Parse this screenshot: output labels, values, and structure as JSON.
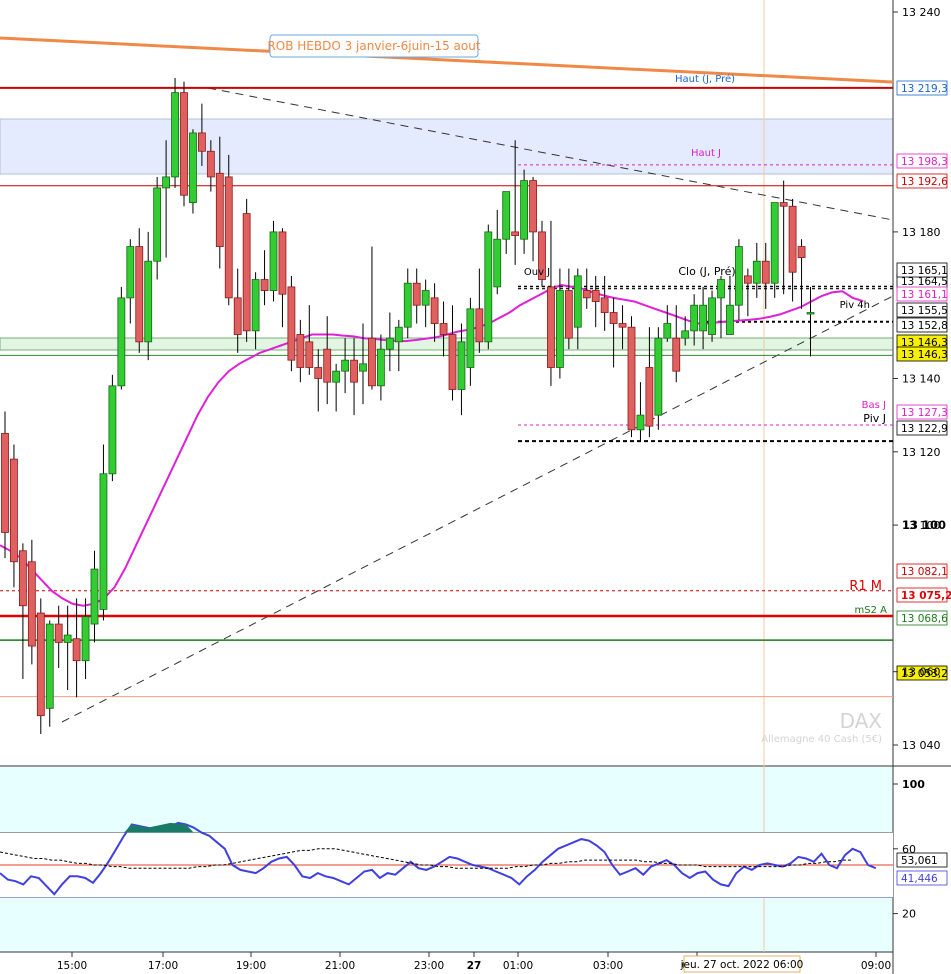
{
  "chart_data": {
    "type": "candlestick",
    "instrument": "DAX",
    "instrument_sub": "Allemagne 40 Cash (5€)",
    "annotation_box": "ROB HEBDO 3 janvier-6juin-15 aout",
    "time_labels": [
      "15:00",
      "17:00",
      "19:00",
      "21:00",
      "23:00",
      "27",
      "01:00",
      "03:00",
      "05:00",
      "09:00"
    ],
    "crosshair_time_label": "jeu. 27 oct. 2022 06:00",
    "price_ticks": [
      "13 240",
      "13 180",
      "13 140",
      "13 120",
      "13 100",
      "13 060",
      "13 040"
    ],
    "y_range": [
      13030,
      13244
    ],
    "price_levels": [
      {
        "label": "Haut (J, Pré)",
        "price": 13219.3,
        "tag": "13 219,3",
        "color": "#cc0000",
        "tag_color": "#1a66cc"
      },
      {
        "label": "Haut J",
        "price": 13198.3,
        "tag": "13 198,3",
        "color": "#e020c8",
        "tag_color": "#e020c8"
      },
      {
        "label": "",
        "price": 13192.6,
        "tag": "13 192,6",
        "color": "#cc0000",
        "tag_color": "#cc0000"
      },
      {
        "label": "Ouv J",
        "price": 13164.5,
        "tag": "13 164,5",
        "color": "#000000",
        "tag_color": "#000000"
      },
      {
        "label": "Clo (J, Pré)",
        "price": 13165.1,
        "tag": "13 165,1",
        "color": "#000000",
        "tag_color": "#000000"
      },
      {
        "label": "",
        "price": 13161.1,
        "tag": "13 161,1",
        "color": "#e020c8",
        "tag_color": "#e020c8"
      },
      {
        "label": "Piv 4h",
        "price": 13155.5,
        "tag": "13 155,5",
        "color": "#000000",
        "tag_color": "#000000"
      },
      {
        "label": "",
        "price": 13152.8,
        "tag": "13 152,8",
        "color": "#000000",
        "tag_color": "#000000"
      },
      {
        "label": "",
        "price": 13146.3,
        "tag": "13 146,3",
        "color": "#2e8b2e",
        "tag_color": "#000000"
      },
      {
        "label": "Bas J",
        "price": 13127.3,
        "tag": "13 127,3",
        "color": "#e020c8",
        "tag_color": "#e020c8"
      },
      {
        "label": "Piv J",
        "price": 13122.9,
        "tag": "13 122,9",
        "color": "#000000",
        "tag_color": "#000000"
      },
      {
        "label": "",
        "price": 13082.1,
        "tag": "13 082,1",
        "color": "#cc0000",
        "tag_color": "#cc0000"
      },
      {
        "label": "R1 M",
        "price": 13075.2,
        "tag": "13 075,2",
        "color": "#e00000",
        "tag_color": "#e00000"
      },
      {
        "label": "mS2 A",
        "price": 13068.6,
        "tag": "13 068,6",
        "color": "#1a7a1a",
        "tag_color": "#1a7a1a"
      },
      {
        "label": "",
        "price": 13053.2,
        "tag": "13 053,2",
        "color": "#f0a080",
        "tag_color": "#000000"
      }
    ],
    "candles": [
      [
        13125,
        13131,
        13091,
        13098
      ],
      [
        13118,
        13122,
        13083,
        13090
      ],
      [
        13093,
        13095,
        13058,
        13078
      ],
      [
        13090,
        13096,
        13062,
        13067
      ],
      [
        13076,
        13080,
        13043,
        13048
      ],
      [
        13050,
        13074,
        13045,
        13073
      ],
      [
        13073,
        13078,
        13061,
        13068
      ],
      [
        13068,
        13078,
        13055,
        13070
      ],
      [
        13069,
        13080,
        13053,
        13063
      ],
      [
        13063,
        13080,
        13058,
        13075
      ],
      [
        13073,
        13093,
        13068,
        13088
      ],
      [
        13077,
        13122,
        13074,
        13114
      ],
      [
        13114,
        13141,
        13112,
        13138
      ],
      [
        13138,
        13165,
        13137,
        13162
      ],
      [
        13162,
        13178,
        13155,
        13176
      ],
      [
        13176,
        13181,
        13147,
        13150
      ],
      [
        13150,
        13180,
        13145,
        13172
      ],
      [
        13172,
        13195,
        13167,
        13192
      ],
      [
        13192,
        13205,
        13173,
        13195
      ],
      [
        13195,
        13222,
        13192,
        13218
      ],
      [
        13218,
        13221,
        13187,
        13190
      ],
      [
        13188,
        13208,
        13185,
        13207
      ],
      [
        13207,
        13215,
        13198,
        13202
      ],
      [
        13202,
        13205,
        13191,
        13195
      ],
      [
        13196,
        13206,
        13170,
        13176
      ],
      [
        13195,
        13201,
        13160,
        13162
      ],
      [
        13162,
        13170,
        13147,
        13152
      ],
      [
        13185,
        13189,
        13150,
        13153
      ],
      [
        13153,
        13169,
        13148,
        13167
      ],
      [
        13167,
        13175,
        13160,
        13164
      ],
      [
        13164,
        13183,
        13161,
        13180
      ],
      [
        13180,
        13181,
        13154,
        13163
      ],
      [
        13165,
        13168,
        13142,
        13145
      ],
      [
        13152,
        13156,
        13139,
        13143
      ],
      [
        13150,
        13160,
        13141,
        13143
      ],
      [
        13143,
        13148,
        13131,
        13140
      ],
      [
        13148,
        13157,
        13133,
        13139
      ],
      [
        13139,
        13144,
        13131,
        13142
      ],
      [
        13142,
        13151,
        13136,
        13145
      ],
      [
        13145,
        13151,
        13130,
        13139
      ],
      [
        13142,
        13155,
        13133,
        13144
      ],
      [
        13151,
        13176,
        13137,
        13138
      ],
      [
        13138,
        13152,
        13134,
        13148
      ],
      [
        13148,
        13158,
        13142,
        13151
      ],
      [
        13150,
        13156,
        13142,
        13154
      ],
      [
        13154,
        13170,
        13151,
        13166
      ],
      [
        13166,
        13170,
        13155,
        13160
      ],
      [
        13160,
        13167,
        13154,
        13164
      ],
      [
        13162,
        13166,
        13150,
        13155
      ],
      [
        13155,
        13161,
        13146,
        13152
      ],
      [
        13152,
        13160,
        13134,
        13137
      ],
      [
        13137,
        13155,
        13130,
        13150
      ],
      [
        13143,
        13162,
        13138,
        13159
      ],
      [
        13159,
        13170,
        13147,
        13150
      ],
      [
        13150,
        13182,
        13148,
        13180
      ],
      [
        13165,
        13186,
        13163,
        13178
      ],
      [
        13178,
        13191,
        13174,
        13191
      ],
      [
        13180,
        13205,
        13171,
        13179
      ],
      [
        13178,
        13197,
        13174,
        13194
      ],
      [
        13194,
        13195,
        13172,
        13180
      ],
      [
        13180,
        13183,
        13165,
        13167
      ],
      [
        13165,
        13183,
        13138,
        13143
      ],
      [
        13143,
        13170,
        13140,
        13164
      ],
      [
        13164,
        13170,
        13148,
        13151
      ],
      [
        13154,
        13170,
        13148,
        13168
      ],
      [
        13164,
        13170,
        13159,
        13162
      ],
      [
        13164,
        13168,
        13154,
        13161
      ],
      [
        13162,
        13168,
        13153,
        13158
      ],
      [
        13158,
        13162,
        13143,
        13155
      ],
      [
        13155,
        13160,
        13148,
        13154
      ],
      [
        13154,
        13157,
        13124,
        13126
      ],
      [
        13126,
        13139,
        13123,
        13130
      ],
      [
        13143,
        13154,
        13124,
        13127
      ],
      [
        13130,
        13154,
        13126,
        13151
      ],
      [
        13151,
        13160,
        13150,
        13155
      ],
      [
        13151,
        13160,
        13139,
        13142
      ],
      [
        13151,
        13157,
        13149,
        13153
      ],
      [
        13153,
        13163,
        13149,
        13160
      ],
      [
        13153,
        13165,
        13148,
        13160
      ],
      [
        13152,
        13164,
        13150,
        13162
      ],
      [
        13162,
        13168,
        13151,
        13167
      ],
      [
        13152,
        13168,
        13157,
        13160
      ],
      [
        13160,
        13178,
        13156,
        13176
      ],
      [
        13168,
        13170,
        13157,
        13166
      ],
      [
        13166,
        13177,
        13162,
        13172
      ],
      [
        13172,
        13177,
        13159,
        13166
      ],
      [
        13166,
        13185,
        13162,
        13188
      ],
      [
        13188,
        13194,
        13163,
        13187
      ],
      [
        13187,
        13189,
        13161,
        13169
      ],
      [
        13176,
        13178,
        13159,
        13173
      ],
      [
        13158,
        13165,
        13146,
        13158
      ]
    ],
    "ma_pink": [
      13094.5,
      13093,
      13091,
      13088,
      13085,
      13082,
      13080,
      13078.5,
      13078,
      13078.5,
      13080,
      13083,
      13088,
      13094,
      13100,
      13106,
      13112,
      13118,
      13124,
      13130,
      13135,
      13139,
      13142,
      13144,
      13145.5,
      13147,
      13148,
      13149,
      13150,
      13151,
      13152,
      13152,
      13152,
      13151.7,
      13151.5,
      13151,
      13150.8,
      13150.5,
      13150.3,
      13150.2,
      13150.5,
      13150.9,
      13151.3,
      13152,
      13152.8,
      13153.3,
      13154,
      13155,
      13156.5,
      13158,
      13160,
      13161.5,
      13163,
      13164.5,
      13165.5,
      13165,
      13164.5,
      13163.5,
      13162.7,
      13162,
      13161.5,
      13161,
      13160,
      13159,
      13158,
      13157,
      13156,
      13155,
      13155,
      13155.3,
      13155.6,
      13155.8,
      13156,
      13156.3,
      13156.8,
      13157.5,
      13158.5,
      13159.5,
      13161,
      13162.5,
      13163.5,
      13163.8,
      13162,
      13161.1
    ],
    "indicator": {
      "ticks": [
        "100",
        "60",
        "20"
      ],
      "value_blue": "41,446",
      "value_black": "53,061",
      "blue": [
        45,
        41,
        40,
        38,
        43,
        42,
        37,
        32,
        38,
        43,
        43,
        42,
        39,
        45,
        52,
        60,
        68,
        75,
        74,
        73,
        72,
        73,
        74,
        76,
        75,
        73,
        70,
        68,
        64,
        60,
        50,
        47,
        46,
        45,
        48,
        52,
        54,
        55,
        50,
        43,
        42,
        45,
        43,
        42,
        40,
        38,
        42,
        46,
        47,
        42,
        45,
        44,
        48,
        52,
        48,
        47,
        49,
        52,
        55,
        54,
        52,
        50,
        49,
        48,
        46,
        44,
        42,
        38,
        43,
        47,
        52,
        56,
        60,
        62,
        64,
        66,
        65,
        62,
        58,
        50,
        44,
        46,
        48,
        44,
        49,
        51,
        53,
        50,
        45,
        42,
        45,
        46,
        41,
        38,
        37,
        45,
        49,
        47,
        50,
        51,
        50,
        49,
        51,
        55,
        54,
        52,
        57,
        50,
        48,
        56,
        60,
        58,
        50,
        48
      ],
      "black": [
        58,
        57,
        56,
        55,
        54,
        54,
        53,
        53,
        52,
        51,
        51,
        50,
        50,
        49,
        49,
        48,
        48,
        48,
        48,
        48,
        48,
        48,
        48,
        49,
        49,
        50,
        50,
        51,
        52,
        53,
        54,
        55,
        56,
        57,
        58,
        59,
        59,
        60,
        60,
        60,
        59,
        58,
        57,
        56,
        55,
        54,
        53,
        52,
        51,
        50,
        50,
        49,
        49,
        48,
        48,
        48,
        48,
        48,
        48,
        48,
        49,
        49,
        50,
        50,
        51,
        51,
        52,
        52,
        53,
        53,
        53,
        53,
        53,
        53,
        53,
        52,
        52,
        51,
        51,
        50,
        50,
        50,
        49,
        49,
        49,
        49,
        49,
        49,
        49,
        49,
        49,
        49,
        50,
        50,
        51,
        51,
        52,
        52,
        53,
        53
      ],
      "range": [
        0,
        100
      ]
    }
  }
}
